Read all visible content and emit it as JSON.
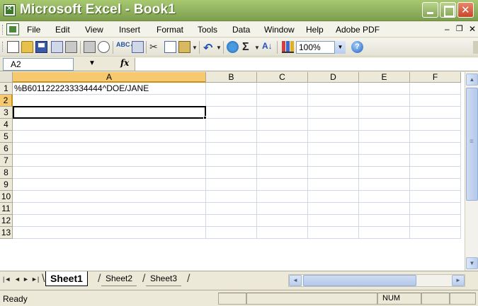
{
  "window": {
    "title": "Microsoft Excel - Book1"
  },
  "menubar": {
    "items": [
      {
        "label": "File"
      },
      {
        "label": "Edit"
      },
      {
        "label": "View"
      },
      {
        "label": "Insert"
      },
      {
        "label": "Format"
      },
      {
        "label": "Tools"
      },
      {
        "label": "Data"
      },
      {
        "label": "Window"
      },
      {
        "label": "Help"
      },
      {
        "label": "Adobe PDF"
      }
    ]
  },
  "toolbar": {
    "zoom": "100%",
    "icons": [
      "new-icon",
      "open-icon",
      "save-icon",
      "permission-icon",
      "print-icon",
      "print-preview-icon",
      "spelling-icon",
      "research-icon",
      "cut-icon",
      "copy-icon",
      "paste-icon",
      "undo-icon",
      "hyperlink-icon",
      "autosum-icon",
      "sort-ascending-icon",
      "chart-wizard-icon",
      "help-icon"
    ]
  },
  "formula_bar": {
    "name_box": "A2",
    "fx": "fx",
    "formula": ""
  },
  "grid": {
    "columns": [
      "A",
      "B",
      "C",
      "D",
      "E",
      "F"
    ],
    "rows": [
      "1",
      "2",
      "3",
      "4",
      "5",
      "6",
      "7",
      "8",
      "9",
      "10",
      "11",
      "12",
      "13"
    ],
    "cells": {
      "A1": "%B6011222233334444^DOE/JANE"
    },
    "active_cell": "A2"
  },
  "sheets": {
    "tabs": [
      {
        "label": "Sheet1",
        "active": true
      },
      {
        "label": "Sheet2",
        "active": false
      },
      {
        "label": "Sheet3",
        "active": false
      }
    ]
  },
  "statusbar": {
    "status": "Ready",
    "num": "NUM"
  },
  "colors": {
    "title_bar": "#94b562",
    "active_header": "#f7c96e",
    "gridline": "#d0d7e5"
  }
}
